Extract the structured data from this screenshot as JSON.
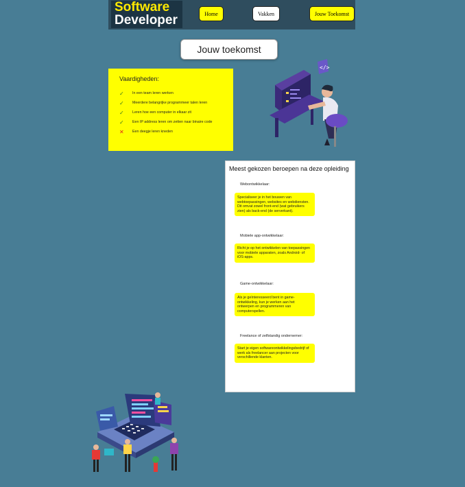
{
  "header": {
    "logo_line1": "Software",
    "logo_line2": "Developer",
    "nav": {
      "home": "Home",
      "vakken": "Vakken",
      "toekomst": "Jouw Toekomst"
    }
  },
  "page_title": "Jouw toekomst",
  "skills": {
    "title": "Vaardigheden:",
    "items": [
      {
        "text": "In een team leren werken",
        "status": "check"
      },
      {
        "text": "Meerdere belangrijke programmeer talen leren",
        "status": "check"
      },
      {
        "text": "Leren hoe een computer in elkaar zit",
        "status": "check"
      },
      {
        "text": "Een IP address leren om zetten naar binaire code",
        "status": "check"
      },
      {
        "text": "Een deegje leren kneden",
        "status": "cross"
      }
    ]
  },
  "careers": {
    "title": "Meest gekozen beroepen na deze opleiding",
    "items": [
      {
        "label": "Webontwikkelaar:",
        "description": "Specialiseer je in het bouwen van webtoepassingen, websites en webdiensten. Dit omvat zowel front-end (wat gebruikers zien) als back-end (de serverkant)."
      },
      {
        "label": "Mobiele app-ontwikkelaar:",
        "description": "Richt je op het ontwikkelen van toepassingen voor mobiele apparaten, zoals Android- of iOS-apps."
      },
      {
        "label": "Game-ontwikkelaar:",
        "description": "Als je geïnteresseerd bent in game-ontwikkeling, kun je werken aan het ontwerpen en programmeren van computerspellen."
      },
      {
        "label": "Freelance of zelfstandig ondernemer:",
        "description": "Start je eigen softwareontwikkelingsbedrijf of werk als freelancer aan projecten voor verschillende klanten."
      }
    ]
  },
  "icons": {
    "check": "✓",
    "cross": "✕"
  },
  "colors": {
    "background": "#487d95",
    "accent_yellow": "#ffff00",
    "header_bg": "#2f4d5e"
  }
}
